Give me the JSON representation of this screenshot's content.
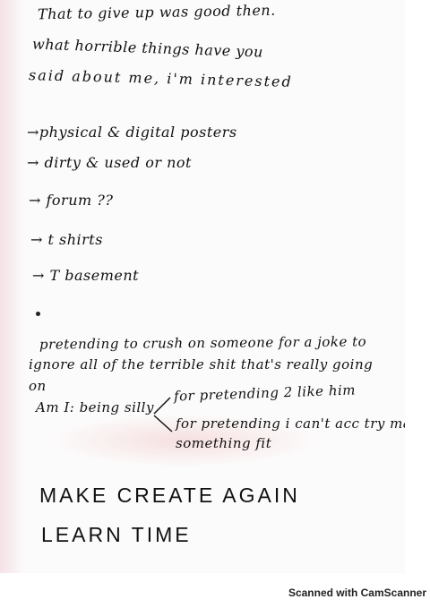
{
  "note": {
    "line1": "That to give up was good then.",
    "line2": "what horrible things have you",
    "line3": "said about me, i'm interested",
    "bullets": [
      "→physical & digital posters",
      "→ dirty & used or not",
      "→ forum ??",
      "→ t shirts",
      "→ T basement"
    ],
    "pretend1": "pretending to crush on someone for a joke to",
    "pretend2": "ignore all of the terrible shit that's really going",
    "pretend3": "on",
    "am_label": "Am I: being silly",
    "branch1": "for pretending 2 like him",
    "branch2a": "for pretending i can't acc try make",
    "branch2b": "something fit",
    "caps1": "MAKE CREATE AGAIN",
    "caps2": "LEARN TIME"
  },
  "footer": "Scanned with CamScanner"
}
